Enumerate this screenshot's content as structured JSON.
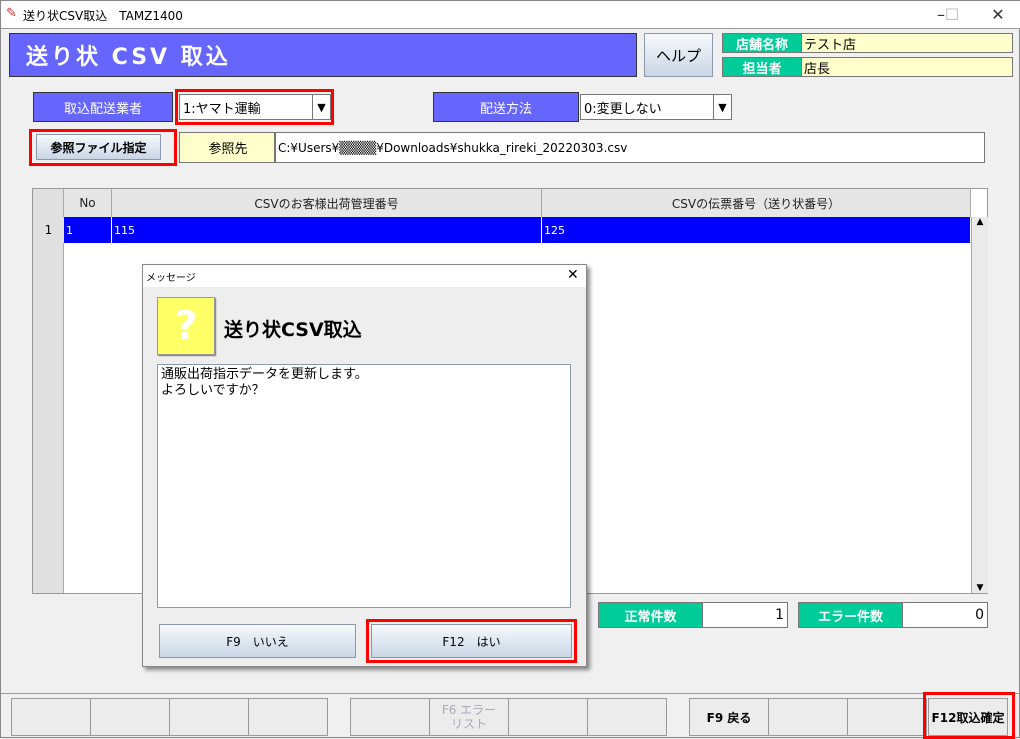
{
  "window": {
    "title": "送り状CSV取込　TAMZ1400",
    "minimize": "–",
    "maximize": "☐",
    "close": "✕"
  },
  "header": {
    "title": "送り状 CSV 取込",
    "help": "ヘルプ",
    "store_label": "店舗名称",
    "store_value": "テスト店",
    "staff_label": "担当者",
    "staff_value": "店長"
  },
  "form": {
    "carrier_label": "取込配送業者",
    "carrier_value": "1:ヤマト運輸",
    "method_label": "配送方法",
    "method_value": "0:変更しない",
    "file_button": "参照ファイル指定",
    "ref_label": "参照先",
    "ref_path": "C:¥Users¥▒▒▒▒¥Downloads¥shukka_rireki_20220303.csv"
  },
  "table": {
    "columns": [
      "No",
      "CSVのお客様出荷管理番号",
      "CSVの伝票番号（送り状番号）"
    ],
    "rows": [
      {
        "row": "1",
        "no": "1",
        "mgmt": "115",
        "slip": "125"
      }
    ]
  },
  "counts": {
    "ok_label": "正常件数",
    "ok_value": "1",
    "err_label": "エラー件数",
    "err_value": "0"
  },
  "dialog": {
    "title": "メッセージ",
    "heading": "送り状CSV取込",
    "icon": "?",
    "message": "通販出荷指示データを更新します。\nよろしいですか？",
    "no": "F9　いいえ",
    "yes": "F12　はい",
    "close": "✕"
  },
  "fkeys": {
    "f6": "F6 エラー\nリスト",
    "f9": "F9 戻る",
    "f12": "F12取込確定"
  }
}
